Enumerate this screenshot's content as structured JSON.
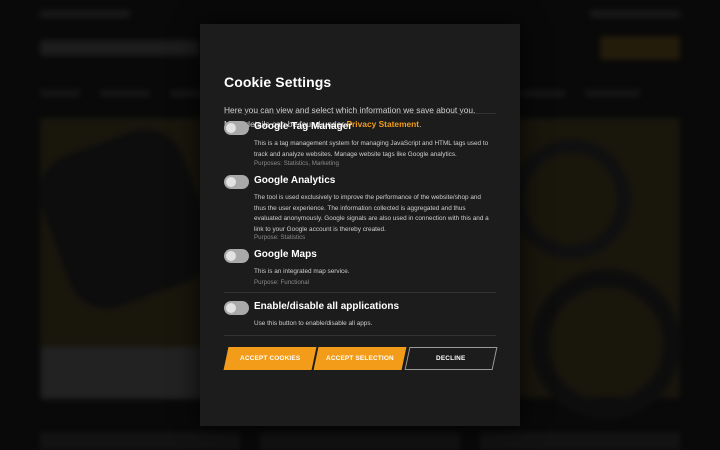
{
  "dialog": {
    "title": "Cookie Settings",
    "intro": "Here you can view and select which information we save about you.  More details can be found under",
    "privacy_link": "Privacy Statement",
    "intro_end": "."
  },
  "services": [
    {
      "name": "Google Tag Manager",
      "description": "This is a tag management system for managing JavaScript and HTML tags used to track and analyze websites. Manage website tags like Google analytics.",
      "purpose": "Purposes: Statistics, Marketing",
      "enabled": false
    },
    {
      "name": "Google Analytics",
      "description": "The tool is used exclusively to improve the performance of the website/shop and thus the user experience. The information collected is aggregated and thus evaluated anonymously. Google signals are also used in connection with this and a link to your Google account is thereby created.",
      "purpose": "Purpose: Statistics",
      "enabled": false
    },
    {
      "name": "Google Maps",
      "description": "This is an integrated map service.",
      "purpose": "Purpose: Functional",
      "enabled": false
    }
  ],
  "all_toggle": {
    "name": "Enable/disable all applications",
    "description": "Use this button to enable/disable all apps.",
    "enabled": false
  },
  "buttons": {
    "accept_cookies": "ACCEPT COOKIES",
    "accept_selection": "ACCEPT SELECTION",
    "decline": "DECLINE"
  },
  "colors": {
    "accent": "#f39c1a",
    "modal_bg": "#1c1c1c",
    "toggle_off": "#a9a9a9"
  }
}
